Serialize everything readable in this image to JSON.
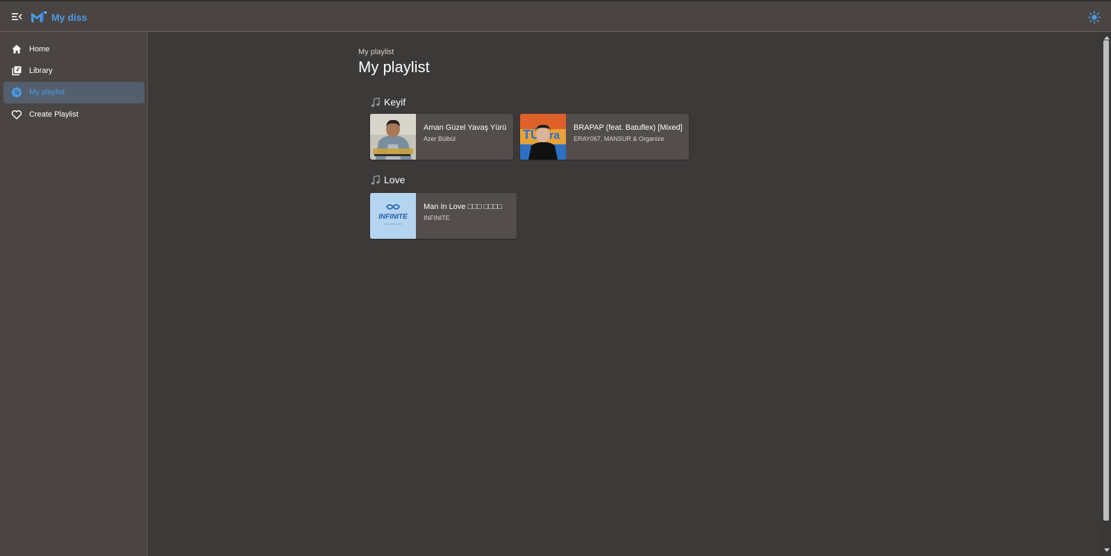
{
  "header": {
    "app_title": "My diss",
    "menu_icon": "menu-collapse-icon",
    "logo_icon": "logo-icon",
    "theme_icon": "sun-icon"
  },
  "sidebar": {
    "items": [
      {
        "label": "Home",
        "icon": "home-icon"
      },
      {
        "label": "Library",
        "icon": "library-icon"
      },
      {
        "label": "My playlist",
        "icon": "playlist-icon",
        "active": true
      },
      {
        "label": "Create Playlist",
        "icon": "heart-icon"
      }
    ]
  },
  "main": {
    "breadcrumb": "My playlist",
    "title": "My playlist",
    "playlists": [
      {
        "name": "Keyif",
        "songs": [
          {
            "title": "Aman Güzel Yavaş Yürü",
            "artist": "Azer Bülbül"
          },
          {
            "title": "BRAPAP (feat. Batuflex) [Mixed]",
            "artist": "ERAY067, MANSUR & Organize"
          }
        ]
      },
      {
        "name": "Love",
        "songs": [
          {
            "title": "Man In Love □□□ □□□□",
            "artist": "INFINITE",
            "cover_text": "INFINITE"
          }
        ]
      }
    ]
  },
  "colors": {
    "accent": "#4a9be8",
    "background": "#3c3a39",
    "surface": "#4a4543",
    "card": "#534d4c",
    "active_nav": "#545f6d"
  }
}
